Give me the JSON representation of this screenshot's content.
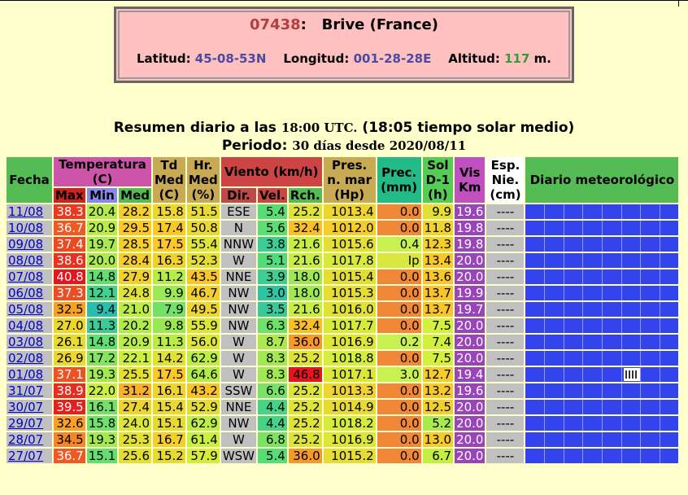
{
  "station": {
    "code": "07438",
    "sep": ":",
    "name": "Brive (France)",
    "lat_label": "Latitud:",
    "lat": "45-08-53N",
    "lon_label": "Longitud:",
    "lon": "001-28-28E",
    "alt_label": "Altitud:",
    "alt": "117",
    "alt_unit": "m."
  },
  "summary": {
    "line1_a": "Resumen diario a las",
    "line1_time": "18:00 UTC.",
    "line1_b": "(18:05 tiempo solar medio)",
    "line2_a": "Periodo:",
    "line2_num": "30 días desde 2020/08/11"
  },
  "headers": {
    "fecha": "Fecha",
    "temp": "Temperatura (C)",
    "max": "Max",
    "min": "Min",
    "med": "Med",
    "td": "Td Med (C)",
    "hr": "Hr. Med (%)",
    "viento": "Viento (km/h)",
    "dir": "Dir.",
    "vel": "Vel.",
    "rch": "Rch.",
    "pres": "Pres. n. mar (Hp)",
    "prec": "Prec. (mm)",
    "sol": "Sol D-1 (h)",
    "vis": "Vis Km",
    "esp": "Esp. Nie. (cm)",
    "diario": "Diario meteorológico"
  },
  "rows": [
    {
      "date": "11/08",
      "max": "38.3",
      "min": "20.4",
      "med": "28.2",
      "td": "15.8",
      "hr": "51.5",
      "dir": "ESE",
      "vel": "5.4",
      "rch": "25.2",
      "pres": "1013.4",
      "prec": "0.0",
      "sol": "9.9",
      "vis": "19.6",
      "esp": "----"
    },
    {
      "date": "10/08",
      "max": "36.7",
      "min": "20.9",
      "med": "29.5",
      "td": "17.4",
      "hr": "50.8",
      "dir": "N",
      "vel": "5.6",
      "rch": "32.4",
      "pres": "1012.0",
      "prec": "0.0",
      "sol": "11.8",
      "vis": "19.8",
      "esp": "----"
    },
    {
      "date": "09/08",
      "max": "37.4",
      "min": "19.7",
      "med": "28.5",
      "td": "17.5",
      "hr": "55.4",
      "dir": "NNW",
      "vel": "3.8",
      "rch": "21.6",
      "pres": "1015.6",
      "prec": "0.4",
      "sol": "12.3",
      "vis": "19.8",
      "esp": "----"
    },
    {
      "date": "08/08",
      "max": "38.6",
      "min": "20.0",
      "med": "28.4",
      "td": "16.3",
      "hr": "52.3",
      "dir": "W",
      "vel": "5.1",
      "rch": "21.6",
      "pres": "1017.8",
      "prec": "Ip",
      "sol": "13.4",
      "vis": "20.0",
      "esp": "----"
    },
    {
      "date": "07/08",
      "max": "40.8",
      "min": "14.8",
      "med": "27.9",
      "td": "11.2",
      "hr": "43.5",
      "dir": "NNE",
      "vel": "3.9",
      "rch": "18.0",
      "pres": "1015.4",
      "prec": "0.0",
      "sol": "13.6",
      "vis": "20.0",
      "esp": "----"
    },
    {
      "date": "06/08",
      "max": "37.3",
      "min": "12.1",
      "med": "24.8",
      "td": "9.9",
      "hr": "46.7",
      "dir": "NW",
      "vel": "3.0",
      "rch": "18.0",
      "pres": "1015.3",
      "prec": "0.0",
      "sol": "13.7",
      "vis": "19.9",
      "esp": "----"
    },
    {
      "date": "05/08",
      "max": "32.5",
      "min": "9.4",
      "med": "21.0",
      "td": "7.9",
      "hr": "49.5",
      "dir": "NW",
      "vel": "3.5",
      "rch": "21.6",
      "pres": "1016.0",
      "prec": "0.0",
      "sol": "13.7",
      "vis": "19.7",
      "esp": "----"
    },
    {
      "date": "04/08",
      "max": "27.0",
      "min": "11.3",
      "med": "20.2",
      "td": "9.8",
      "hr": "55.9",
      "dir": "NW",
      "vel": "6.3",
      "rch": "32.4",
      "pres": "1017.7",
      "prec": "0.0",
      "sol": "7.5",
      "vis": "20.0",
      "esp": "----"
    },
    {
      "date": "03/08",
      "max": "26.1",
      "min": "14.8",
      "med": "20.9",
      "td": "11.3",
      "hr": "56.0",
      "dir": "W",
      "vel": "8.7",
      "rch": "36.0",
      "pres": "1016.9",
      "prec": "0.2",
      "sol": "7.4",
      "vis": "20.0",
      "esp": "----"
    },
    {
      "date": "02/08",
      "max": "26.9",
      "min": "17.2",
      "med": "22.1",
      "td": "14.2",
      "hr": "62.9",
      "dir": "W",
      "vel": "8.3",
      "rch": "25.2",
      "pres": "1018.8",
      "prec": "0.0",
      "sol": "7.5",
      "vis": "20.0",
      "esp": "----"
    },
    {
      "date": "01/08",
      "max": "37.1",
      "min": "19.3",
      "med": "25.5",
      "td": "17.5",
      "hr": "64.6",
      "dir": "W",
      "vel": "8.3",
      "rch": "46.8",
      "pres": "1017.1",
      "prec": "3.0",
      "sol": "12.7",
      "vis": "19.4",
      "esp": "----",
      "storm": true
    },
    {
      "date": "31/07",
      "max": "38.9",
      "min": "22.0",
      "med": "31.2",
      "td": "16.1",
      "hr": "43.2",
      "dir": "SSW",
      "vel": "6.6",
      "rch": "25.2",
      "pres": "1013.3",
      "prec": "0.0",
      "sol": "13.2",
      "vis": "19.6",
      "esp": "----"
    },
    {
      "date": "30/07",
      "max": "39.5",
      "min": "16.1",
      "med": "27.4",
      "td": "15.4",
      "hr": "52.9",
      "dir": "NNE",
      "vel": "4.4",
      "rch": "25.2",
      "pres": "1014.9",
      "prec": "0.0",
      "sol": "12.5",
      "vis": "20.0",
      "esp": "----"
    },
    {
      "date": "29/07",
      "max": "32.6",
      "min": "15.8",
      "med": "24.0",
      "td": "15.1",
      "hr": "62.9",
      "dir": "NW",
      "vel": "4.4",
      "rch": "25.2",
      "pres": "1018.2",
      "prec": "0.0",
      "sol": "5.2",
      "vis": "20.0",
      "esp": "----"
    },
    {
      "date": "28/07",
      "max": "34.5",
      "min": "19.3",
      "med": "25.3",
      "td": "16.7",
      "hr": "61.4",
      "dir": "W",
      "vel": "6.8",
      "rch": "25.2",
      "pres": "1016.9",
      "prec": "0.0",
      "sol": "13.0",
      "vis": "20.0",
      "esp": "----"
    },
    {
      "date": "27/07",
      "max": "36.7",
      "min": "15.1",
      "med": "25.6",
      "td": "15.2",
      "hr": "57.9",
      "dir": "WSW",
      "vel": "5.4",
      "rch": "36.0",
      "pres": "1015.2",
      "prec": "0.0",
      "sol": "6.7",
      "vis": "20.0",
      "esp": "----"
    }
  ],
  "colors": {
    "page_bg": "#ffffcc",
    "station_bg": "#ffc0c0",
    "diario_bg": "#3344ee",
    "vis_bg": "#9944bb"
  }
}
